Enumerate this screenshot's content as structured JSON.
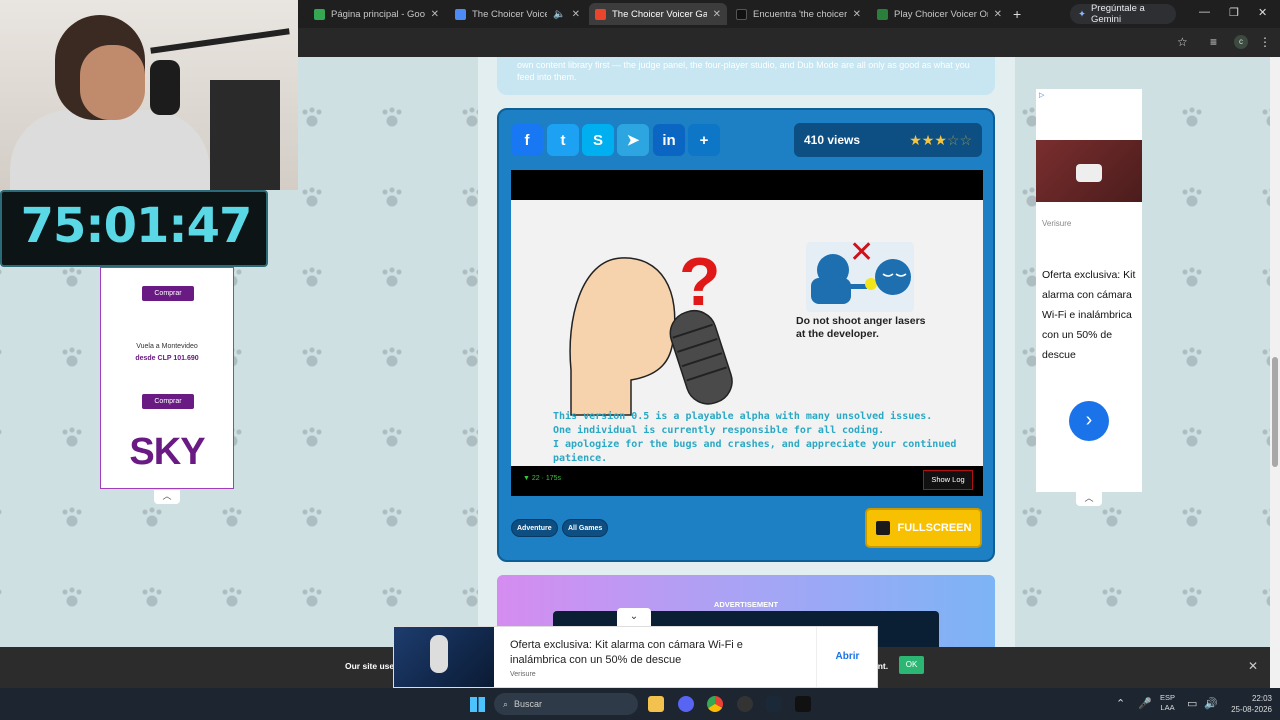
{
  "browser": {
    "tabs": [
      {
        "title": "Página principal - Google",
        "favicon_color": "#34a853",
        "active": false
      },
      {
        "title": "The Choicer Voicer - P",
        "favicon_color": "#4c8bf5",
        "active": false
      },
      {
        "title": "The Choicer Voicer Game",
        "favicon_color": "#e8452c",
        "active": true
      },
      {
        "title": "Encuentra 'the choicer voi",
        "favicon_color": "#111111",
        "active": false
      },
      {
        "title": "Play Choicer Voicer Online",
        "favicon_color": "#2a7f3a",
        "active": false
      }
    ],
    "new_tab": "+",
    "gemini_label": "Pregúntale a Gemini",
    "profile_initial": "c"
  },
  "page": {
    "top_card_text": "own content library first — the judge panel, the four-player studio, and Dub Mode are all only as good as what you feed into them.",
    "share_buttons": [
      {
        "name": "facebook",
        "glyph": "f"
      },
      {
        "name": "twitter",
        "glyph": "t"
      },
      {
        "name": "skype",
        "glyph": "S"
      },
      {
        "name": "telegram",
        "glyph": "➤"
      },
      {
        "name": "linkedin",
        "glyph": "in"
      },
      {
        "name": "share-more",
        "glyph": "+"
      }
    ],
    "views": "410 views",
    "rating": {
      "filled": 3,
      "total": 5
    },
    "game": {
      "warning_caption_1": "Do not shoot anger lasers",
      "warning_caption_2": "at the developer.",
      "notice_1": "This version 0.5 is a playable alpha with many unsolved issues.",
      "notice_2": "One individual is currently responsible for all coding.",
      "notice_3": "I apologize for the bugs and crashes, and appreciate your continued patience.",
      "fps": "▼ 22 · 175s",
      "show_log": "Show Log"
    },
    "tags": [
      "Adventure",
      "All Games"
    ],
    "fullscreen_label": "FULLSCREEN",
    "advertisement_label": "ADVERTISEMENT"
  },
  "left_ad": {
    "buy_label": "Comprar",
    "flight_line": "Vuela a Montevideo",
    "flight_price": "desde CLP 101.690",
    "logo": "SKY"
  },
  "right_ad": {
    "brand": "Verisure",
    "offer": "Oferta exclusiva: Kit alarma con cámara Wi-Fi e inalámbrica con un 50% de descue"
  },
  "cookie_bar": {
    "text_start": "Our site use",
    "text_end": "ant.",
    "ok": "OK"
  },
  "bottom_ad": {
    "title": "Oferta exclusiva: Kit alarma con cámara Wi-Fi e inalámbrica con un 50% de descue",
    "brand": "Verisure",
    "open": "Abrir"
  },
  "overlay": {
    "timer": "75:01:47"
  },
  "taskbar": {
    "search_placeholder": "Buscar",
    "lang_1": "ESP",
    "lang_2": "LAA",
    "time": "22:03",
    "date": "25-08-2026"
  }
}
